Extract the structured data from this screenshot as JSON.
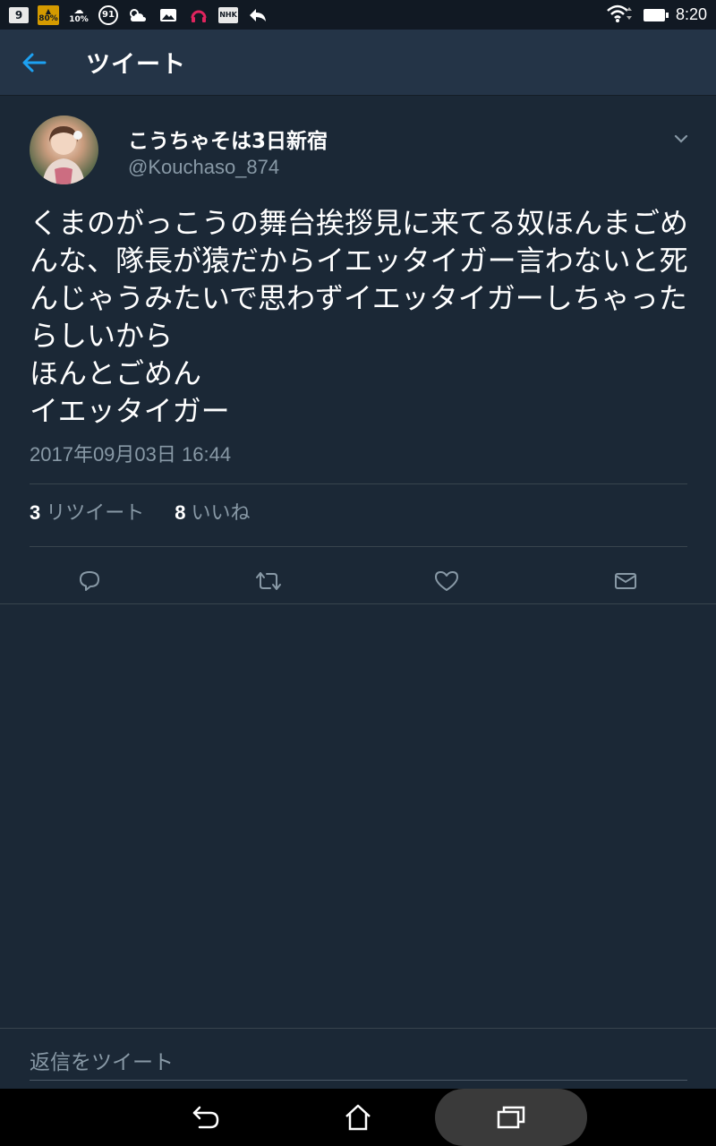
{
  "status_bar": {
    "icons": [
      {
        "name": "sim-icon",
        "text": "9"
      },
      {
        "name": "battery-80-icon",
        "text": "80%"
      },
      {
        "name": "weather-icon",
        "text": "10%"
      },
      {
        "name": "badge-91-icon",
        "text": "91"
      },
      {
        "name": "cloud-sun-icon",
        "text": ""
      },
      {
        "name": "gallery-icon",
        "text": ""
      },
      {
        "name": "headphone-icon",
        "text": ""
      },
      {
        "name": "nhk-icon",
        "text": "NHK"
      },
      {
        "name": "reply-icon",
        "text": ""
      }
    ],
    "time": "8:20"
  },
  "app_bar": {
    "title": "ツイート"
  },
  "tweet": {
    "display_name": "こうちゃそは3日新宿",
    "handle": "@Kouchaso_874",
    "text": "くまのがっこうの舞台挨拶見に来てる奴ほんまごめんな、隊長が猿だからイエッタイガー言わないと死んじゃうみたいで思わずイエッタイガーしちゃったらしいから\nほんとごめん\nイエッタイガー",
    "timestamp": "2017年09月03日 16:44",
    "retweets": {
      "count": "3",
      "label": "リツイート"
    },
    "likes": {
      "count": "8",
      "label": "いいね"
    }
  },
  "reply": {
    "placeholder": "返信をツイート"
  },
  "colors": {
    "background": "#1b2836",
    "app_bar": "#243447",
    "accent": "#1da1f2",
    "muted_text": "#8899a6"
  }
}
